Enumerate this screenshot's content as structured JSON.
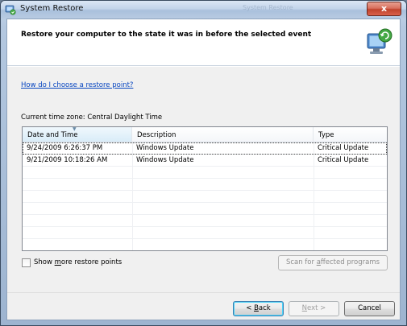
{
  "window": {
    "title": "System Restore",
    "background_title": "System Restore",
    "close_label": "x"
  },
  "header": {
    "heading": "Restore your computer to the state it was in before the selected event"
  },
  "main": {
    "help_link": "How do I choose a restore point?",
    "timezone": "Current time zone: Central Daylight Time",
    "columns": [
      "Date and Time",
      "Description",
      "Type"
    ],
    "rows": [
      {
        "date": "9/24/2009 6:26:37 PM",
        "description": "Windows Update",
        "type": "Critical Update"
      },
      {
        "date": "9/21/2009 10:18:26 AM",
        "description": "Windows Update",
        "type": "Critical Update"
      }
    ],
    "show_more": {
      "pre": "Show ",
      "accel": "m",
      "post": "ore restore points",
      "checked": false
    },
    "scan_button": {
      "pre": "Scan for ",
      "accel": "a",
      "post": "ffected programs"
    }
  },
  "footer": {
    "back": {
      "pre": "< ",
      "accel": "B",
      "post": "ack"
    },
    "next": {
      "pre": "",
      "accel": "N",
      "post": "ext >"
    },
    "cancel_label": "Cancel"
  },
  "colors": {
    "link": "#0645c0",
    "accent": "#48d4fa",
    "close": "#c0432c"
  }
}
